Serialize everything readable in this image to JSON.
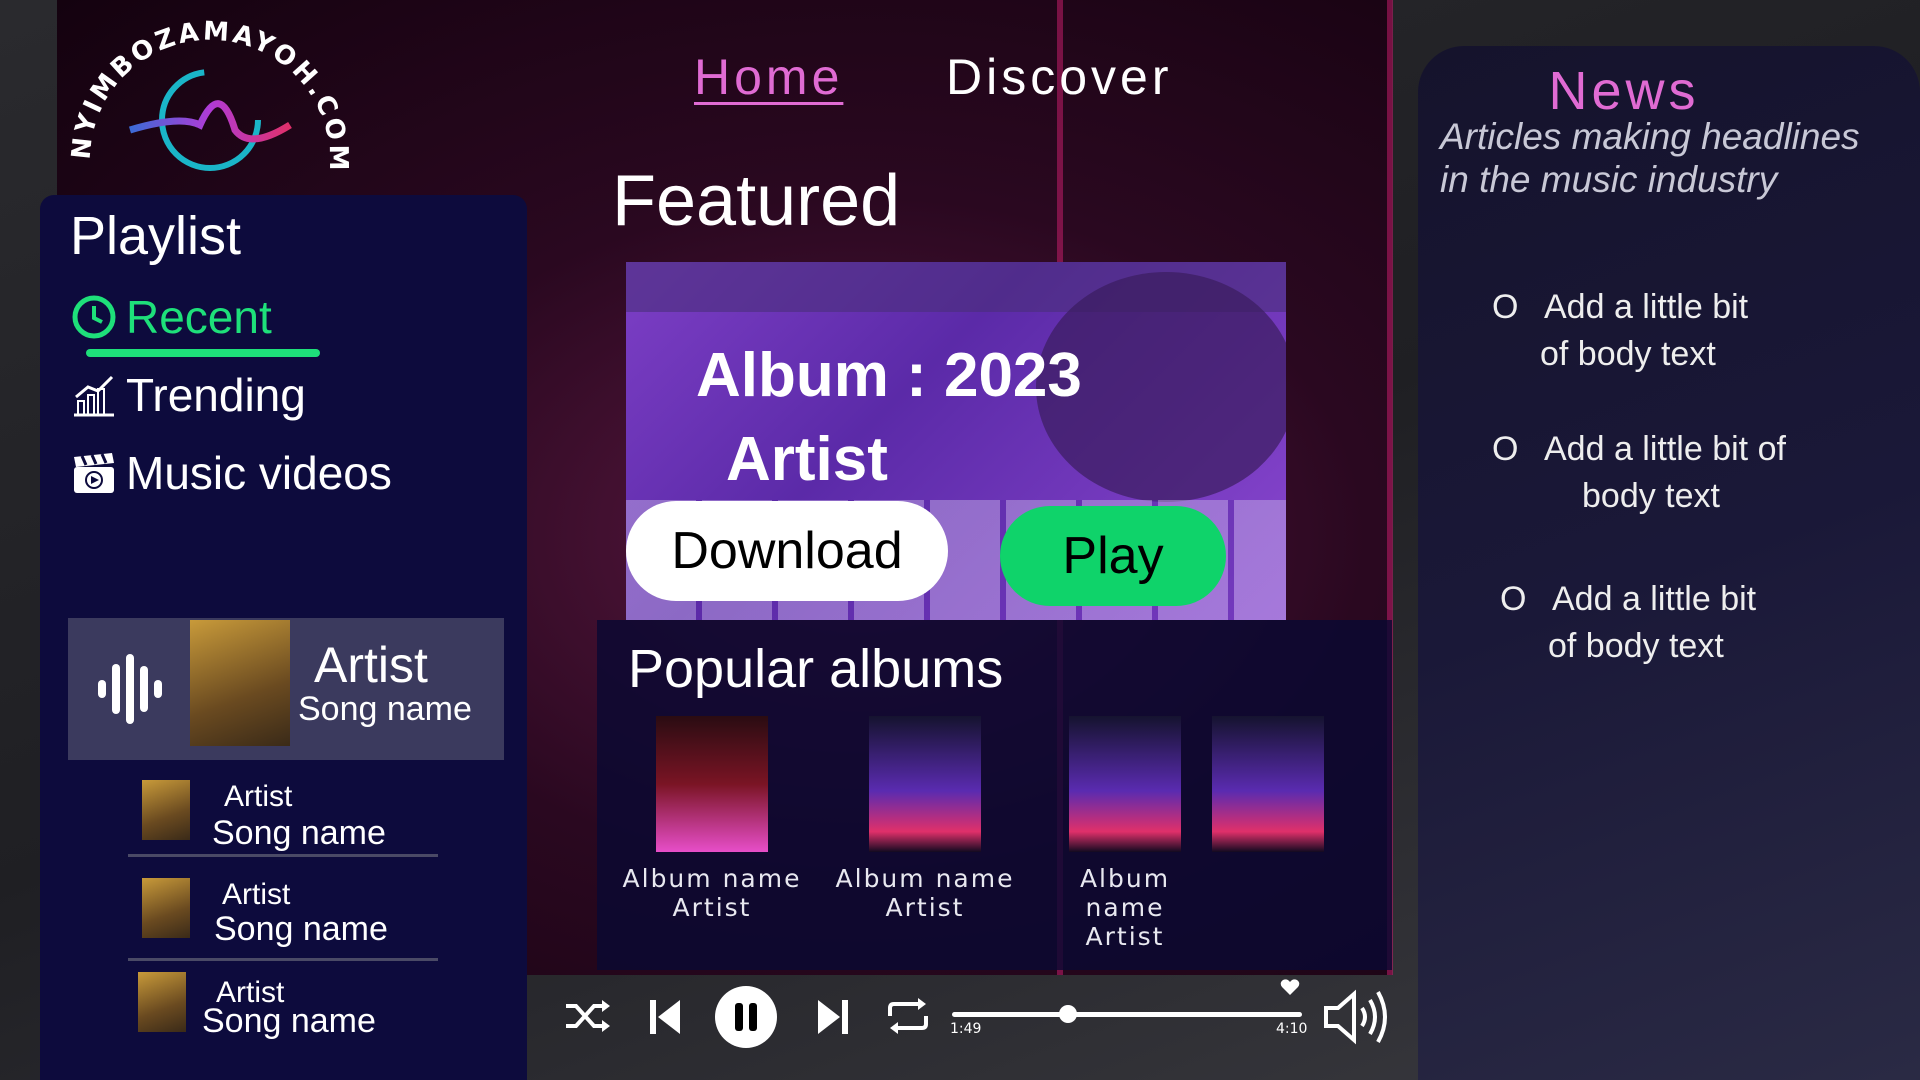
{
  "logo": {
    "text": "NYIMBOZAMAYOH.COM"
  },
  "nav": {
    "home": "Home",
    "discover": "Discover"
  },
  "featured": {
    "title": "Featured",
    "album_line": "Album : 2023",
    "artist_line": "Artist",
    "download_label": "Download",
    "play_label": "Play"
  },
  "popular": {
    "title": "Popular albums",
    "albums": [
      {
        "name": "Album name",
        "artist": "Artist"
      },
      {
        "name": "Album name",
        "artist": "Artist"
      },
      {
        "name": "Album name",
        "artist": "Artist"
      },
      {
        "name": "",
        "artist": ""
      }
    ]
  },
  "sidebar": {
    "title": "Playlist",
    "items": [
      {
        "label": "Recent",
        "icon": "clock-icon"
      },
      {
        "label": "Trending",
        "icon": "chart-icon"
      },
      {
        "label": "Music videos",
        "icon": "clapperboard-icon"
      }
    ],
    "accent_color": "#1ee07a"
  },
  "now_playing": {
    "artist": "Artist",
    "song": "Song name"
  },
  "queue": [
    {
      "artist": "Artist",
      "song": "Song name"
    },
    {
      "artist": "Artist",
      "song": "Song name"
    },
    {
      "artist": "Artist",
      "song": "Song name"
    }
  ],
  "player": {
    "current_time": "1:49",
    "total_time": "4:10",
    "progress": 0.33,
    "icons": [
      "shuffle-icon",
      "previous-icon",
      "pause-icon",
      "next-icon",
      "repeat-icon",
      "heart-icon",
      "volume-icon"
    ]
  },
  "news": {
    "title": "News",
    "subtitle": "Articles making headlines in the music industry",
    "bullet": "O",
    "items": [
      {
        "line1": "Add a little bit",
        "line2": "of body text"
      },
      {
        "line1": "Add a little bit of",
        "line2": "body text"
      },
      {
        "line1": "Add a little bit",
        "line2": "of body text"
      }
    ],
    "accent_color": "#e06bd3"
  }
}
